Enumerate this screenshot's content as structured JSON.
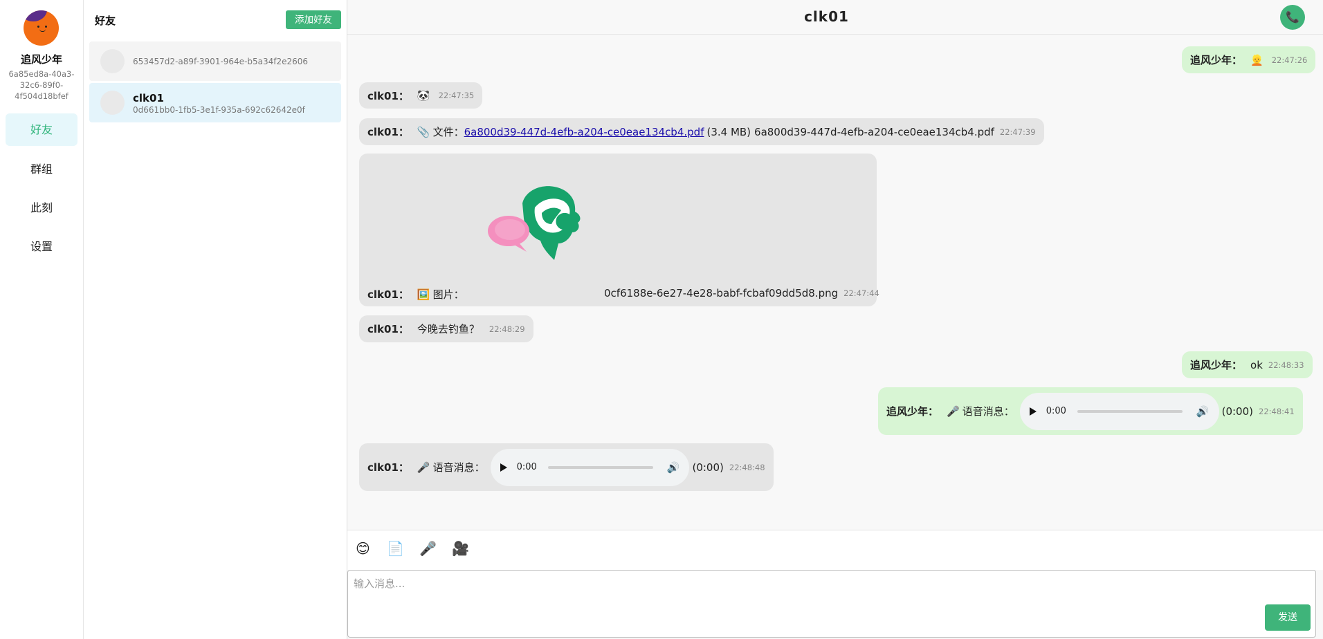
{
  "user": {
    "name": "追风少年",
    "id": "6a85ed8a-40a3-32c6-89f0-4f504d18bfef"
  },
  "nav": {
    "items": [
      {
        "label": "好友",
        "active": true
      },
      {
        "label": "群组"
      },
      {
        "label": "此刻"
      },
      {
        "label": "设置"
      }
    ]
  },
  "friends": {
    "title": "好友",
    "add_label": "添加好友",
    "list": [
      {
        "name": "",
        "id": "653457d2-a89f-3901-964e-b5a34f2e2606"
      },
      {
        "name": "clk01",
        "id": "0d661bb0-1fb5-3e1f-935a-692c62642e0f",
        "selected": true
      }
    ]
  },
  "chat": {
    "title": "clk01",
    "call_icon": "📞",
    "messages": {
      "m1": {
        "sender": "追风少年：",
        "emoji": "👱",
        "time": "22:47:26"
      },
      "m2": {
        "sender": "clk01：",
        "emoji": "🐼",
        "time": "22:47:35"
      },
      "m3": {
        "sender": "clk01：",
        "icon": "📎",
        "label": "文件：",
        "link": "6a800d39-447d-4efb-a204-ce0eae134cb4.pdf",
        "size": "(3.4 MB)",
        "filename": "6a800d39-447d-4efb-a204-ce0eae134cb4.pdf",
        "time": "22:47:39"
      },
      "m4": {
        "sender": "clk01：",
        "icon": "🖼️",
        "label": "图片：",
        "filename": "0cf6188e-6e27-4e28-babf-fcbaf09dd5d8.png",
        "time": "22:47:44"
      },
      "m5": {
        "sender": "clk01：",
        "text": "今晚去钓鱼？",
        "time": "22:48:29"
      },
      "m6": {
        "sender": "追风少年：",
        "text": "ok",
        "time": "22:48:33"
      },
      "m7": {
        "sender": "追风少年：",
        "icon": "🎤",
        "label": "语音消息：",
        "player_time": "0:00",
        "duration": "(0:00)",
        "time": "22:48:41"
      },
      "m8": {
        "sender": "clk01：",
        "icon": "🎤",
        "label": "语音消息：",
        "player_time": "0:00",
        "duration": "(0:00)",
        "time": "22:48:48"
      }
    }
  },
  "toolbar": {
    "emoji": "😊",
    "file": "📄",
    "mic": "🎤",
    "video": "🎥"
  },
  "input": {
    "placeholder": "输入消息...",
    "send_label": "发送"
  },
  "colors": {
    "accent": "#3fb47a",
    "incoming": "#e5e5e5",
    "outgoing": "#d8f5d4"
  }
}
